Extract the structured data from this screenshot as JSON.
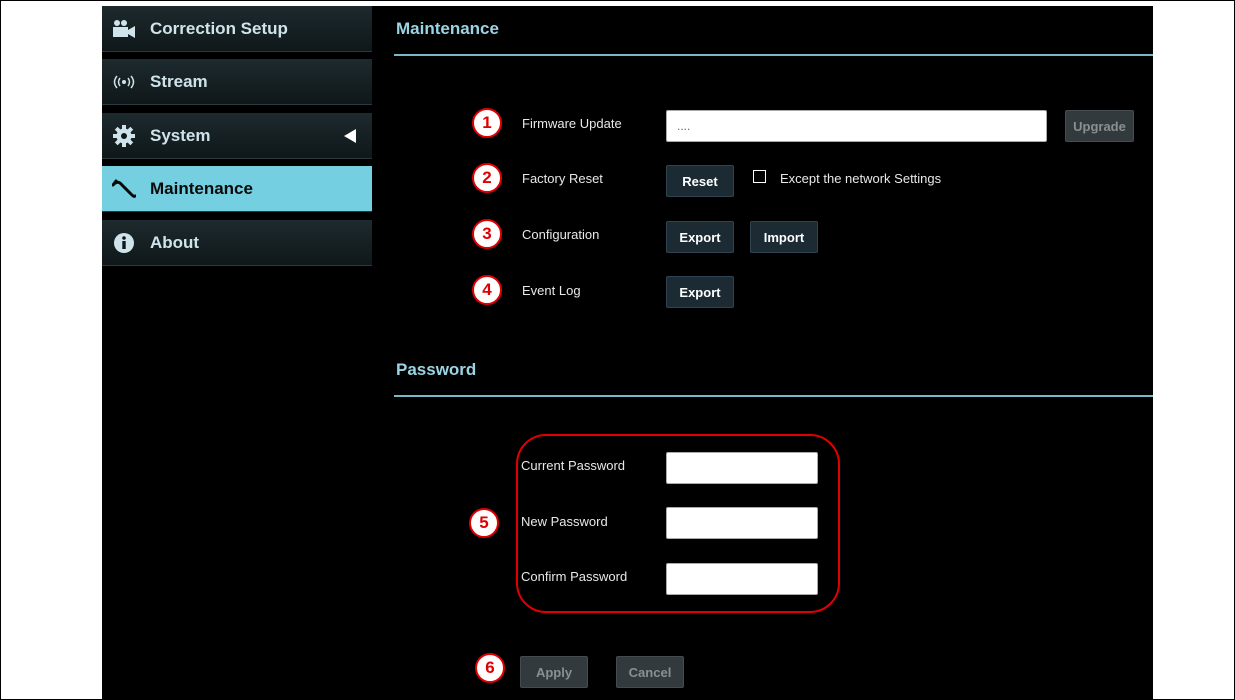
{
  "sidebar": {
    "items": [
      {
        "label": "Correction Setup",
        "icon": "video-camera-icon"
      },
      {
        "label": "Stream",
        "icon": "broadcast-icon"
      },
      {
        "label": "System",
        "icon": "gear-icon"
      },
      {
        "label": "Maintenance",
        "icon": "wrench-icon",
        "active": true
      },
      {
        "label": "About",
        "icon": "info-icon"
      }
    ]
  },
  "maintenance": {
    "title": "Maintenance",
    "firmware": {
      "label": "Firmware Update",
      "value": "....",
      "button": "Upgrade"
    },
    "factory_reset": {
      "label": "Factory Reset",
      "button": "Reset",
      "checkbox_label": "Except the network Settings",
      "checked": false
    },
    "configuration": {
      "label": "Configuration",
      "export_button": "Export",
      "import_button": "Import"
    },
    "event_log": {
      "label": "Event Log",
      "export_button": "Export"
    }
  },
  "password": {
    "title": "Password",
    "current_label": "Current Password",
    "new_label": "New Password",
    "confirm_label": "Confirm Password",
    "apply_button": "Apply",
    "cancel_button": "Cancel"
  },
  "callouts": [
    "1",
    "2",
    "3",
    "4",
    "5",
    "6"
  ],
  "colors": {
    "accent": "#74d0e0",
    "callout": "#e00000",
    "background": "#000000"
  }
}
